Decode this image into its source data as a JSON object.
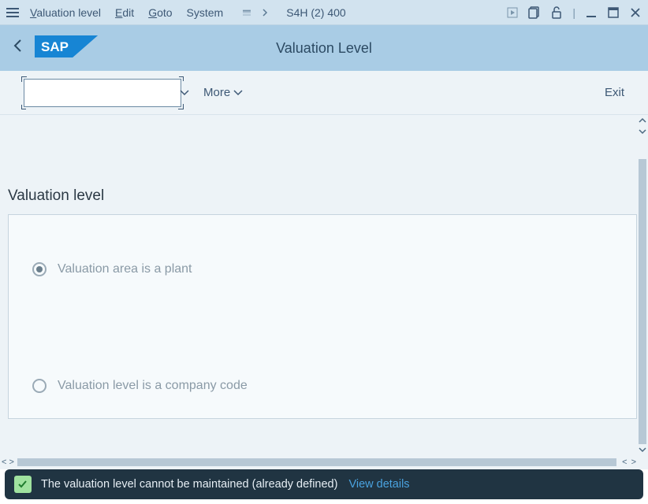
{
  "menubar": {
    "items": [
      {
        "label": "Valuation level",
        "accel": "V"
      },
      {
        "label": "Edit",
        "accel": "E"
      },
      {
        "label": "Goto",
        "accel": "G"
      },
      {
        "label": "System",
        "accel": ""
      }
    ],
    "system_info": "S4H (2) 400"
  },
  "header": {
    "title": "Valuation Level"
  },
  "toolbar": {
    "input_value": "",
    "more_label": "More",
    "exit_label": "Exit"
  },
  "content": {
    "group_heading": "Valuation level",
    "options": [
      {
        "label": "Valuation area is a plant",
        "selected": true
      },
      {
        "label": "Valuation level is a company code",
        "selected": false
      }
    ]
  },
  "status": {
    "message": "The valuation level cannot be maintained (already defined)",
    "link_label": "View details"
  }
}
